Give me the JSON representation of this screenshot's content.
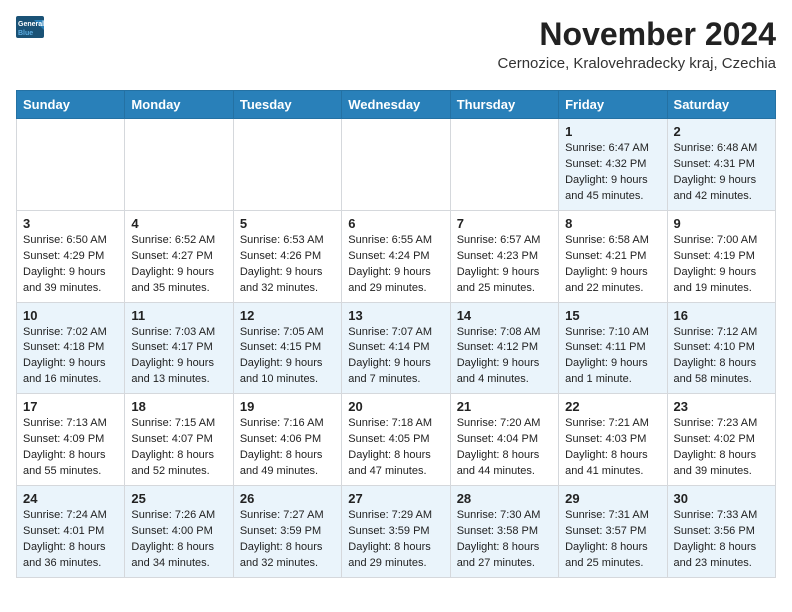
{
  "header": {
    "logo_line1": "General",
    "logo_line2": "Blue",
    "title": "November 2024",
    "subtitle": "Cernozice, Kralovehradecky kraj, Czechia"
  },
  "columns": [
    "Sunday",
    "Monday",
    "Tuesday",
    "Wednesday",
    "Thursday",
    "Friday",
    "Saturday"
  ],
  "weeks": [
    [
      {
        "day": "",
        "info": ""
      },
      {
        "day": "",
        "info": ""
      },
      {
        "day": "",
        "info": ""
      },
      {
        "day": "",
        "info": ""
      },
      {
        "day": "",
        "info": ""
      },
      {
        "day": "1",
        "info": "Sunrise: 6:47 AM\nSunset: 4:32 PM\nDaylight: 9 hours\nand 45 minutes."
      },
      {
        "day": "2",
        "info": "Sunrise: 6:48 AM\nSunset: 4:31 PM\nDaylight: 9 hours\nand 42 minutes."
      }
    ],
    [
      {
        "day": "3",
        "info": "Sunrise: 6:50 AM\nSunset: 4:29 PM\nDaylight: 9 hours\nand 39 minutes."
      },
      {
        "day": "4",
        "info": "Sunrise: 6:52 AM\nSunset: 4:27 PM\nDaylight: 9 hours\nand 35 minutes."
      },
      {
        "day": "5",
        "info": "Sunrise: 6:53 AM\nSunset: 4:26 PM\nDaylight: 9 hours\nand 32 minutes."
      },
      {
        "day": "6",
        "info": "Sunrise: 6:55 AM\nSunset: 4:24 PM\nDaylight: 9 hours\nand 29 minutes."
      },
      {
        "day": "7",
        "info": "Sunrise: 6:57 AM\nSunset: 4:23 PM\nDaylight: 9 hours\nand 25 minutes."
      },
      {
        "day": "8",
        "info": "Sunrise: 6:58 AM\nSunset: 4:21 PM\nDaylight: 9 hours\nand 22 minutes."
      },
      {
        "day": "9",
        "info": "Sunrise: 7:00 AM\nSunset: 4:19 PM\nDaylight: 9 hours\nand 19 minutes."
      }
    ],
    [
      {
        "day": "10",
        "info": "Sunrise: 7:02 AM\nSunset: 4:18 PM\nDaylight: 9 hours\nand 16 minutes."
      },
      {
        "day": "11",
        "info": "Sunrise: 7:03 AM\nSunset: 4:17 PM\nDaylight: 9 hours\nand 13 minutes."
      },
      {
        "day": "12",
        "info": "Sunrise: 7:05 AM\nSunset: 4:15 PM\nDaylight: 9 hours\nand 10 minutes."
      },
      {
        "day": "13",
        "info": "Sunrise: 7:07 AM\nSunset: 4:14 PM\nDaylight: 9 hours\nand 7 minutes."
      },
      {
        "day": "14",
        "info": "Sunrise: 7:08 AM\nSunset: 4:12 PM\nDaylight: 9 hours\nand 4 minutes."
      },
      {
        "day": "15",
        "info": "Sunrise: 7:10 AM\nSunset: 4:11 PM\nDaylight: 9 hours\nand 1 minute."
      },
      {
        "day": "16",
        "info": "Sunrise: 7:12 AM\nSunset: 4:10 PM\nDaylight: 8 hours\nand 58 minutes."
      }
    ],
    [
      {
        "day": "17",
        "info": "Sunrise: 7:13 AM\nSunset: 4:09 PM\nDaylight: 8 hours\nand 55 minutes."
      },
      {
        "day": "18",
        "info": "Sunrise: 7:15 AM\nSunset: 4:07 PM\nDaylight: 8 hours\nand 52 minutes."
      },
      {
        "day": "19",
        "info": "Sunrise: 7:16 AM\nSunset: 4:06 PM\nDaylight: 8 hours\nand 49 minutes."
      },
      {
        "day": "20",
        "info": "Sunrise: 7:18 AM\nSunset: 4:05 PM\nDaylight: 8 hours\nand 47 minutes."
      },
      {
        "day": "21",
        "info": "Sunrise: 7:20 AM\nSunset: 4:04 PM\nDaylight: 8 hours\nand 44 minutes."
      },
      {
        "day": "22",
        "info": "Sunrise: 7:21 AM\nSunset: 4:03 PM\nDaylight: 8 hours\nand 41 minutes."
      },
      {
        "day": "23",
        "info": "Sunrise: 7:23 AM\nSunset: 4:02 PM\nDaylight: 8 hours\nand 39 minutes."
      }
    ],
    [
      {
        "day": "24",
        "info": "Sunrise: 7:24 AM\nSunset: 4:01 PM\nDaylight: 8 hours\nand 36 minutes."
      },
      {
        "day": "25",
        "info": "Sunrise: 7:26 AM\nSunset: 4:00 PM\nDaylight: 8 hours\nand 34 minutes."
      },
      {
        "day": "26",
        "info": "Sunrise: 7:27 AM\nSunset: 3:59 PM\nDaylight: 8 hours\nand 32 minutes."
      },
      {
        "day": "27",
        "info": "Sunrise: 7:29 AM\nSunset: 3:59 PM\nDaylight: 8 hours\nand 29 minutes."
      },
      {
        "day": "28",
        "info": "Sunrise: 7:30 AM\nSunset: 3:58 PM\nDaylight: 8 hours\nand 27 minutes."
      },
      {
        "day": "29",
        "info": "Sunrise: 7:31 AM\nSunset: 3:57 PM\nDaylight: 8 hours\nand 25 minutes."
      },
      {
        "day": "30",
        "info": "Sunrise: 7:33 AM\nSunset: 3:56 PM\nDaylight: 8 hours\nand 23 minutes."
      }
    ]
  ]
}
